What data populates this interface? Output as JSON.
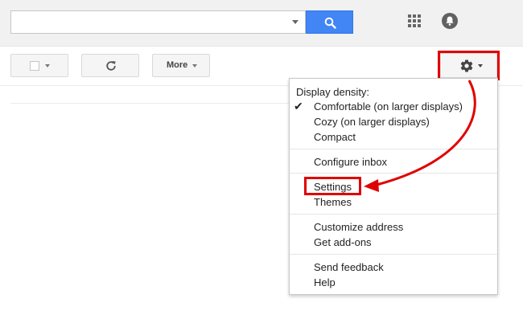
{
  "menu": {
    "header": "Display density:",
    "density_options": [
      "Comfortable (on larger displays)",
      "Cozy (on larger displays)",
      "Compact"
    ],
    "configure_inbox": "Configure inbox",
    "settings": "Settings",
    "themes": "Themes",
    "customize_address": "Customize address",
    "get_addons": "Get add-ons",
    "send_feedback": "Send feedback",
    "help": "Help",
    "selected_density": "Comfortable (on larger displays)"
  },
  "toolbar": {
    "more_label": "More",
    "icons": [
      "checkbox-icon",
      "refresh-icon",
      "gear-icon"
    ]
  },
  "topbar": {
    "icons": [
      "search-icon",
      "apps-icon",
      "notifications-icon"
    ]
  },
  "colors": {
    "search_button": "#4285f4",
    "highlight": "#e00000"
  }
}
